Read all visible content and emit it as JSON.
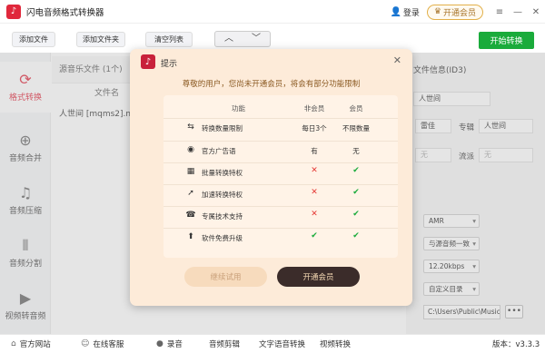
{
  "app": {
    "title": "闪电音频格式转换器",
    "logo_icon": "music-note-icon",
    "login_label": "登录",
    "vip_label": "开通会员"
  },
  "toolbar": {
    "add_file": "添加文件",
    "add_folder": "添加文件夹",
    "clear_list": "清空列表",
    "up_arrow": "︿",
    "down_arrow": "﹀",
    "start": "开始转换"
  },
  "sidebar": {
    "items": [
      {
        "label": "格式转换",
        "icon": "refresh-icon",
        "active": true
      },
      {
        "label": "音频合并",
        "icon": "merge-icon"
      },
      {
        "label": "音频压缩",
        "icon": "compress-icon"
      },
      {
        "label": "音频分割",
        "icon": "split-icon"
      },
      {
        "label": "视频转音频",
        "icon": "video-icon"
      }
    ]
  },
  "filelist": {
    "header": "源音乐文件 (1个)",
    "name_column": "文件名",
    "rows": [
      "人世间 [mqms2].mp"
    ]
  },
  "info": {
    "header": "文件信息(ID3)",
    "title_value": "人世间",
    "artist_label": "雷佳",
    "album_label": "专辑",
    "album_value": "人世间",
    "year_placeholder": "无",
    "genre_label": "流派",
    "genre_placeholder": "无",
    "format": "AMR",
    "channel": "与源音频一致",
    "bitrate": "12.20kbps",
    "output_dir": "自定义目录",
    "path": "C:\\Users\\Public\\Music\\"
  },
  "bottom": {
    "website": "官方网站",
    "service": "在线客服",
    "record": "录音",
    "edit": "音频剪辑",
    "tts": "文字语音转换",
    "video": "视频转换",
    "version": "版本：v3.3.3"
  },
  "dialog": {
    "title": "提示",
    "message": "尊敬的用户，您尚未开通会员，将会有部分功能限制",
    "columns": {
      "feature": "功能",
      "free": "非会员",
      "vip": "会员"
    },
    "rows": [
      {
        "icon": "transfer-icon",
        "feature": "转换数量限制",
        "free": "每日3个",
        "vip": "不限数量"
      },
      {
        "icon": "ad-icon",
        "feature": "官方广告语",
        "free": "有",
        "vip": "无"
      },
      {
        "icon": "grid-icon",
        "feature": "批量转换特权",
        "free": "✕",
        "vip": "✔"
      },
      {
        "icon": "rocket-icon",
        "feature": "加速转换特权",
        "free": "✕",
        "vip": "✔"
      },
      {
        "icon": "support-icon",
        "feature": "专属技术支持",
        "free": "✕",
        "vip": "✔"
      },
      {
        "icon": "upgrade-icon",
        "feature": "软件免费升级",
        "free": "✔",
        "vip": "✔"
      }
    ],
    "continue_label": "继续试用",
    "vip_label": "开通会员"
  }
}
